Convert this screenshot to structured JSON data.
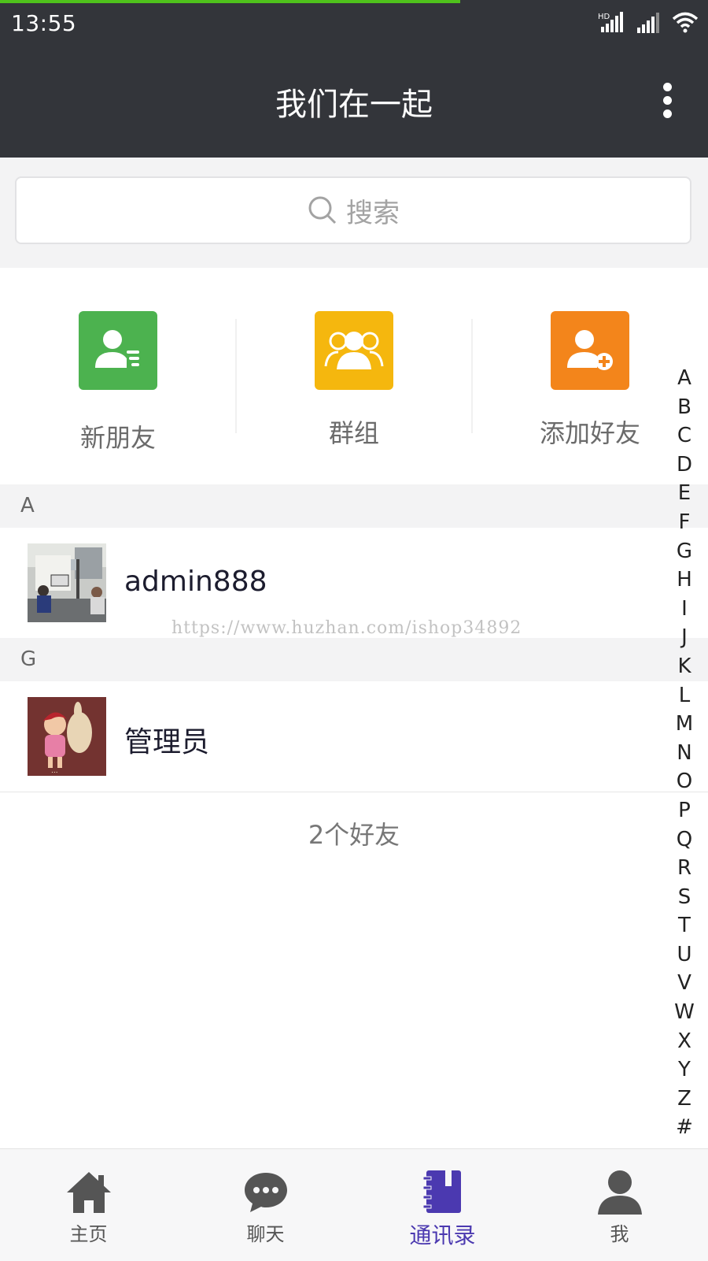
{
  "status_bar": {
    "time": "13:55",
    "progress_fraction": 0.65
  },
  "header": {
    "title": "我们在一起"
  },
  "search": {
    "placeholder": "搜索"
  },
  "quick_actions": [
    {
      "label": "新朋友",
      "icon": "new-friend-icon",
      "color": "#4cb24f"
    },
    {
      "label": "群组",
      "icon": "group-icon",
      "color": "#f5b70e"
    },
    {
      "label": "添加好友",
      "icon": "add-friend-icon",
      "color": "#f3851b"
    }
  ],
  "sections": [
    {
      "letter": "A",
      "contacts": [
        {
          "name": "admin888"
        }
      ]
    },
    {
      "letter": "G",
      "contacts": [
        {
          "name": "管理员"
        }
      ]
    }
  ],
  "friend_count": "2个好友",
  "watermark": "https://www.huzhan.com/ishop34892",
  "alphabet": [
    "A",
    "B",
    "C",
    "D",
    "E",
    "F",
    "G",
    "H",
    "I",
    "J",
    "K",
    "L",
    "M",
    "N",
    "O",
    "P",
    "Q",
    "R",
    "S",
    "T",
    "U",
    "V",
    "W",
    "X",
    "Y",
    "Z",
    "#"
  ],
  "tabs": [
    {
      "label": "主页",
      "icon": "home-icon"
    },
    {
      "label": "聊天",
      "icon": "chat-icon"
    },
    {
      "label": "通讯录",
      "icon": "contacts-book-icon",
      "active": true
    },
    {
      "label": "我",
      "icon": "profile-icon"
    }
  ],
  "colors": {
    "bar": "#33353a",
    "accent": "#4b39b0",
    "progress": "#4fc21c"
  }
}
